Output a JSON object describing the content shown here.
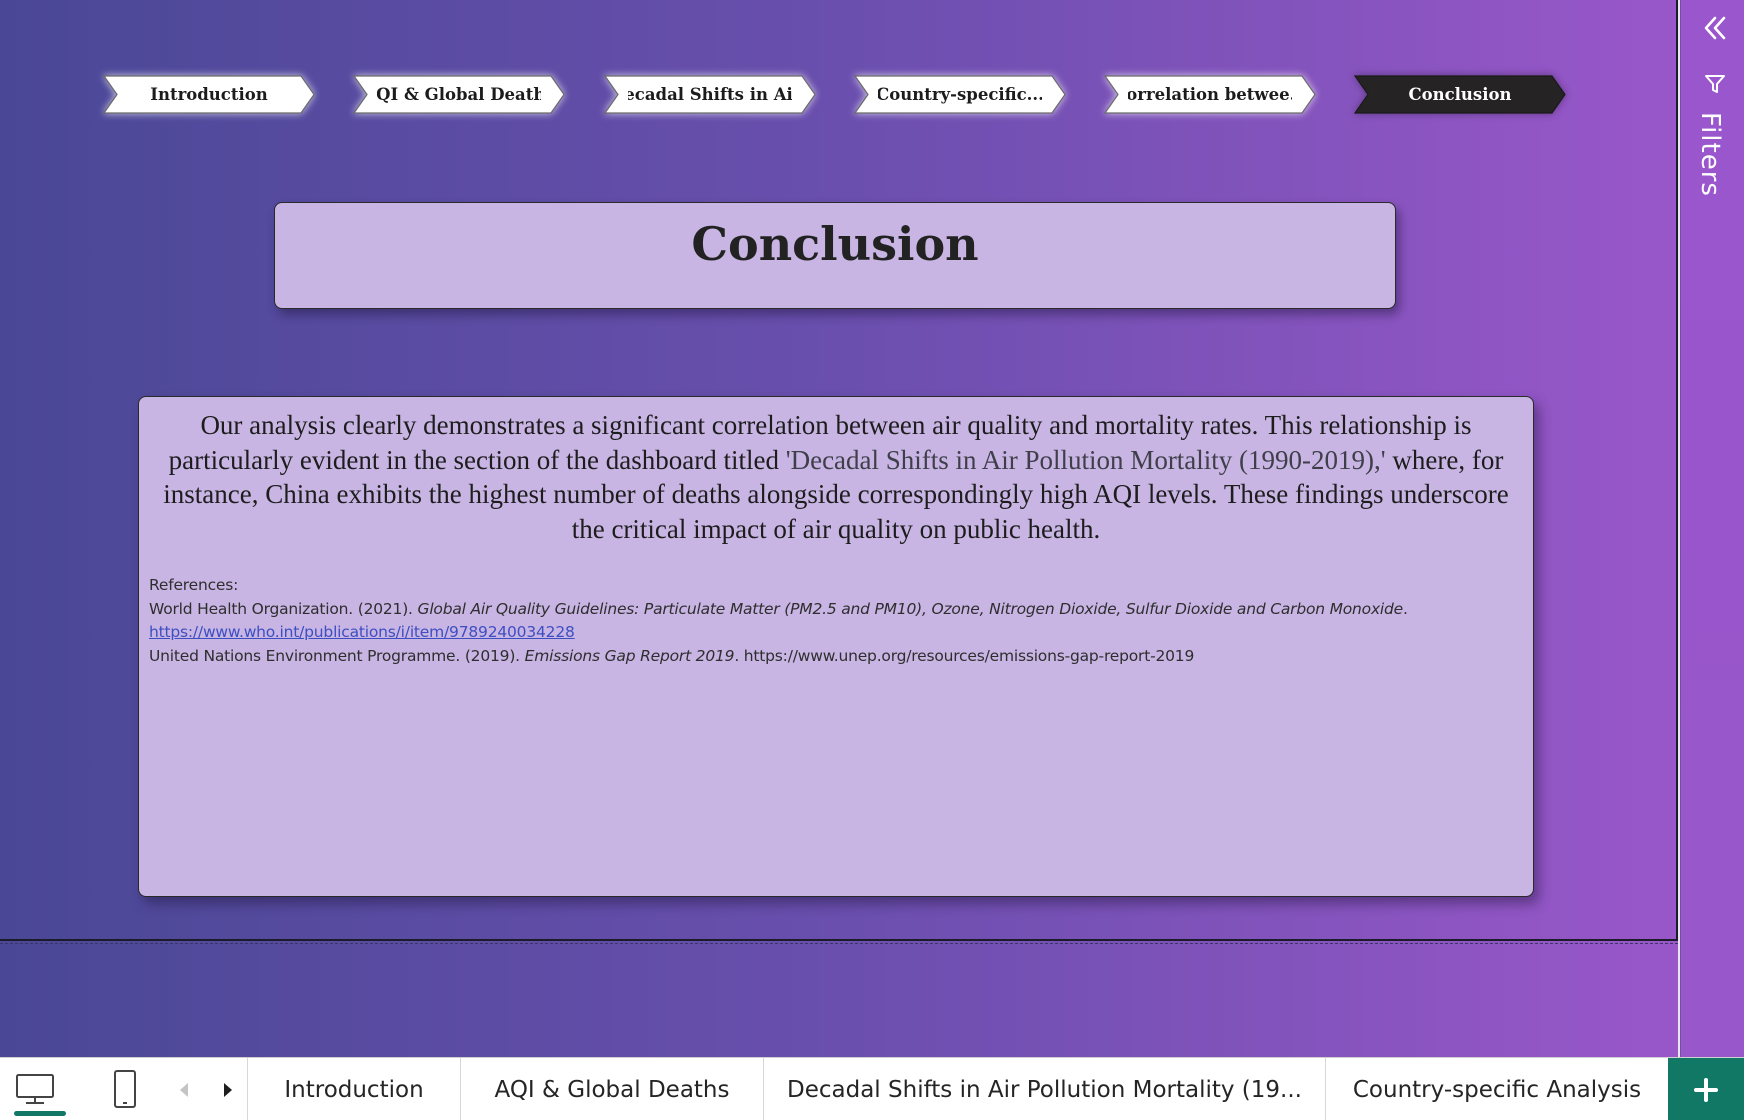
{
  "nav": {
    "chevrons": [
      {
        "label": "Introduction"
      },
      {
        "label": "AQI & Global Deaths"
      },
      {
        "label": "Decadal Shifts in Ai..."
      },
      {
        "label": "Country-specific..."
      },
      {
        "label": "Correlation betwee..."
      },
      {
        "label": "Conclusion",
        "active": true
      }
    ]
  },
  "title": "Conclusion",
  "analysis": {
    "part1": "Our analysis clearly demonstrates a significant correlation between air quality and mortality rates. This relationship is particularly evident in the section of the dashboard titled ",
    "quoted": "'Decadal Shifts in Air Pollution Mortality (1990-2019),'",
    "part2": " where, for instance, China exhibits the highest number of deaths alongside correspondingly high AQI levels. These findings underscore the critical impact of air quality on public health."
  },
  "references": {
    "heading": "References:",
    "ref1_author": "World Health Organization. (2021). ",
    "ref1_title": "Global Air Quality Guidelines: Particulate Matter (PM2.5 and PM10), Ozone, Nitrogen Dioxide, Sulfur Dioxide and Carbon Monoxide",
    "ref1_end": ".",
    "ref1_link": "https://www.who.int/publications/i/item/9789240034228",
    "ref2_author": "United Nations Environment Programme. (2019). ",
    "ref2_title": "Emissions Gap Report 2019",
    "ref2_end": ". https://www.unep.org/resources/emissions-gap-report-2019"
  },
  "filters_pane": {
    "label": "Filters",
    "collapse_icon": "double-chevron-left-icon",
    "filter_icon": "funnel-icon"
  },
  "bottom_bar": {
    "view_buttons": [
      "desktop-icon",
      "mobile-icon"
    ],
    "tabs": [
      "Introduction",
      "AQI & Global Deaths",
      "Decadal Shifts in Air Pollution Mortality (19...",
      "Country-specific Analysis"
    ],
    "add_icon": "plus-icon"
  },
  "colors": {
    "canvas_start": "#4a4896",
    "canvas_end": "#9957c9",
    "box_fill": "#c8b5e4",
    "active_chevron": "#252323",
    "accent": "#117865"
  }
}
